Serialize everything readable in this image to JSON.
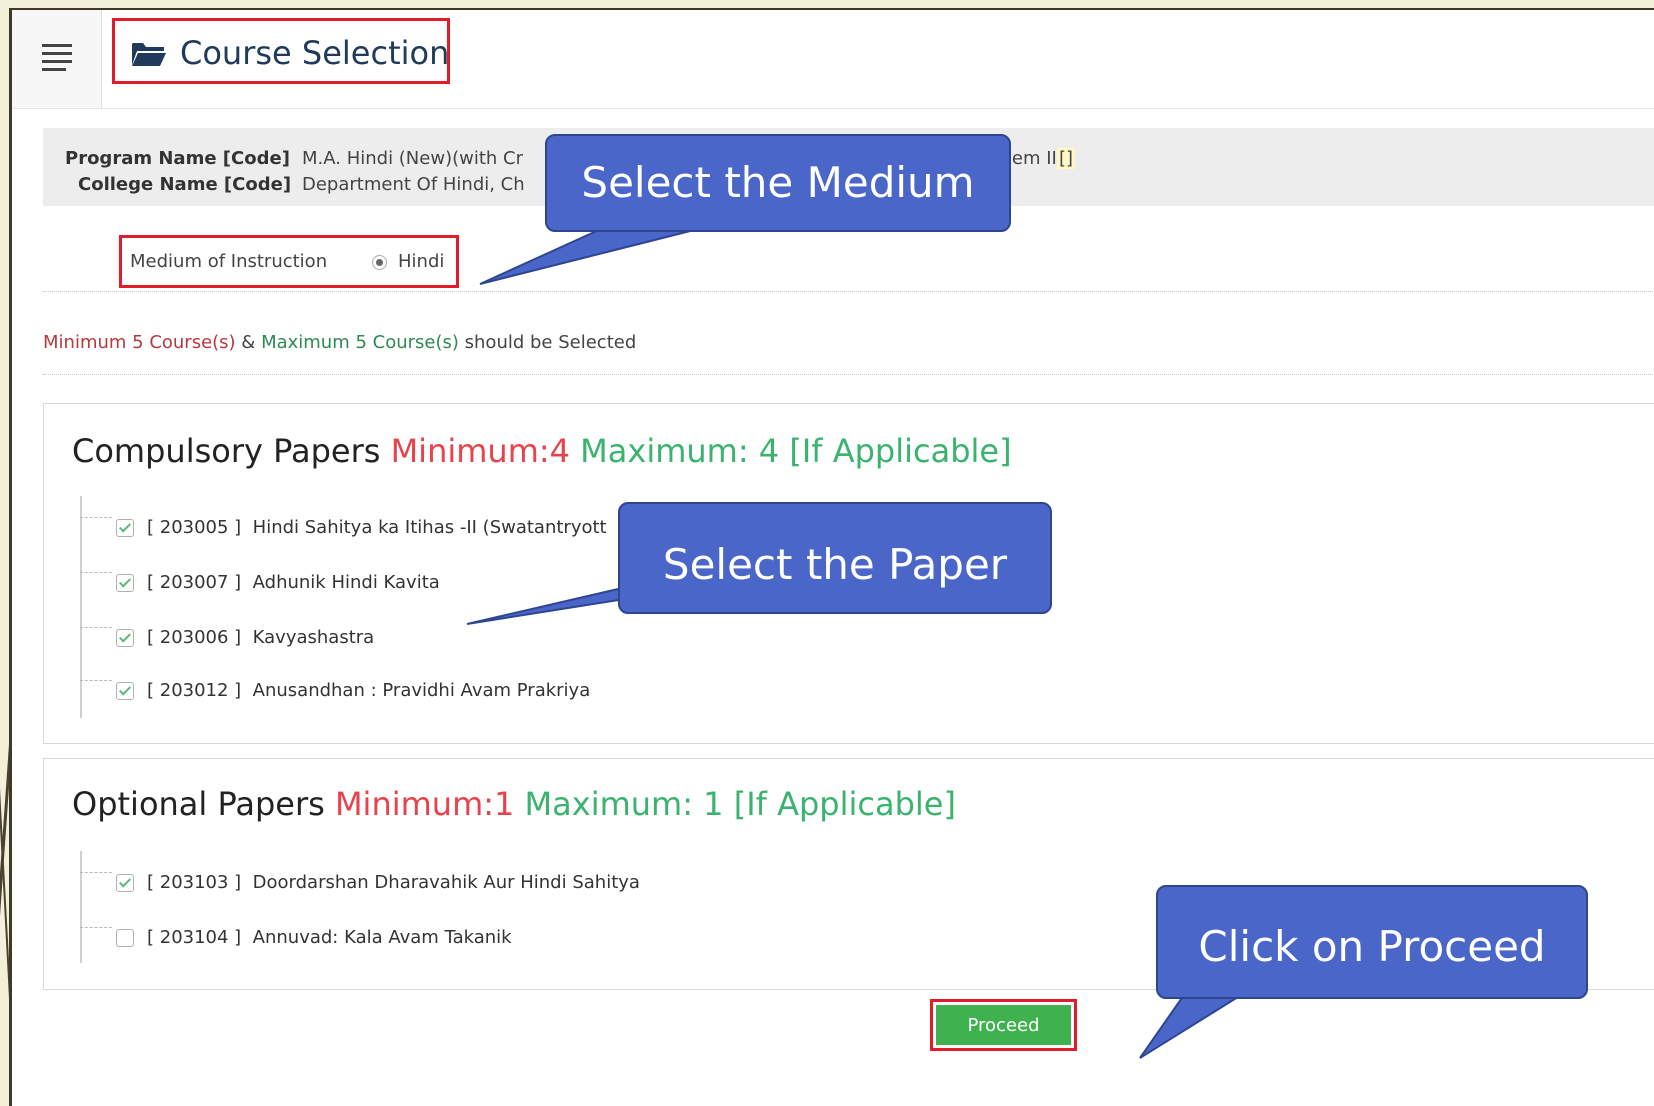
{
  "header": {
    "title": "Course Selection",
    "menu_icon": "hamburger-icon",
    "title_icon": "folder-open-icon"
  },
  "program_info": {
    "program_label": "Program Name [Code]",
    "program_value": "M.A. Hindi (New)(with Cr",
    "program_value_tail": "w) Sem II",
    "program_code": "[]",
    "college_label": "College Name [Code]",
    "college_value": "Department Of Hindi, Ch"
  },
  "medium": {
    "label": "Medium of Instruction",
    "selected": "Hindi"
  },
  "rule": {
    "min_text": "Minimum 5 Course(s)",
    "connector": " & ",
    "max_text": "Maximum 5 Course(s)",
    "suffix": " should be Selected"
  },
  "compulsory": {
    "title": "Compulsory Papers",
    "min": "Minimum:4",
    "max": "Maximum: 4 [If Applicable]",
    "items": [
      {
        "code": "[ 203005 ]",
        "name": "Hindi Sahitya ka Itihas -II (Swatantryott",
        "checked": true
      },
      {
        "code": "[ 203007 ]",
        "name": "Adhunik Hindi Kavita",
        "checked": true
      },
      {
        "code": "[ 203006 ]",
        "name": "Kavyashastra",
        "checked": true
      },
      {
        "code": "[ 203012 ]",
        "name": "Anusandhan : Pravidhi Avam Prakriya",
        "checked": true
      }
    ]
  },
  "optional": {
    "title": "Optional Papers",
    "min": "Minimum:1",
    "max": "Maximum: 1 [If Applicable]",
    "items": [
      {
        "code": "[ 203103 ]",
        "name": "Doordarshan Dharavahik Aur Hindi Sahitya",
        "checked": true
      },
      {
        "code": "[ 203104 ]",
        "name": "Annuvad: Kala Avam Takanik",
        "checked": false
      }
    ]
  },
  "proceed_label": "Proceed",
  "callouts": {
    "medium": "Select the Medium",
    "paper": "Select the Paper",
    "proceed": "Click on Proceed"
  },
  "colors": {
    "highlight_border": "#e21c2b",
    "callout_fill": "#4a66c8",
    "proceed_green": "#3fb24f",
    "min_red": "#e8424d",
    "max_green": "#3ab36e"
  }
}
